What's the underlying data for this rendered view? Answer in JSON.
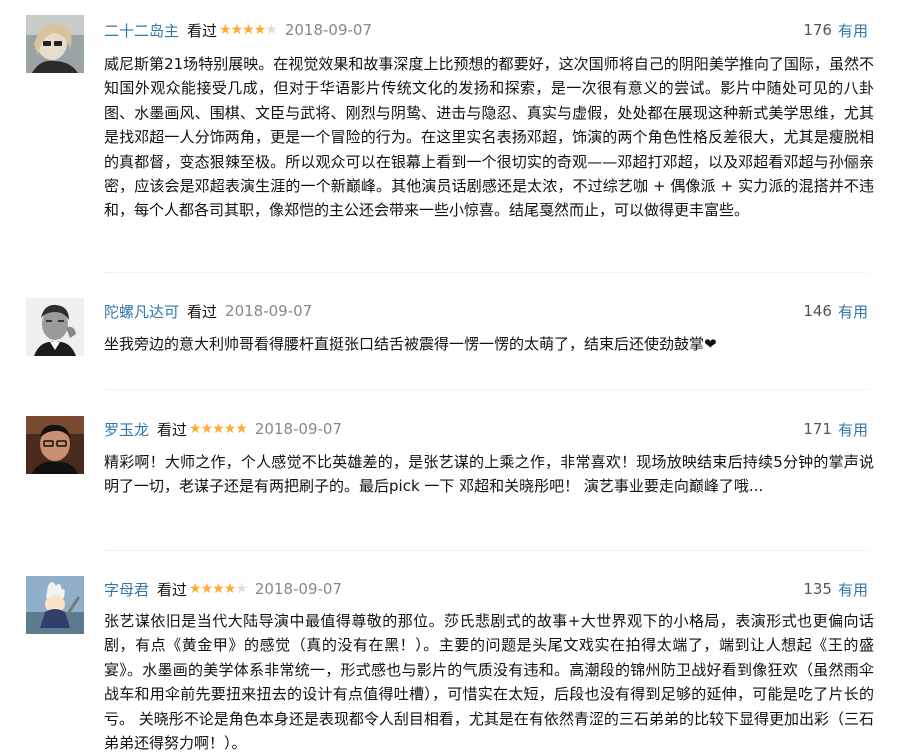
{
  "comments": [
    {
      "username": "二十二岛主",
      "status": "看过",
      "rating": 4,
      "date": "2018-09-07",
      "votes": "176",
      "useful_label": "有用",
      "content": "威尼斯第21场特别展映。在视觉效果和故事深度上比预想的都要好，这次国师将自己的阴阳美学推向了国际，虽然不知国外观众能接受几成，但对于华语影片传统文化的发扬和探索，是一次很有意义的尝试。影片中随处可见的八卦图、水墨画风、围棋、文臣与武将、刚烈与阴鸷、进击与隐忍、真实与虚假，处处都在展现这种新式美学思维，尤其是找邓超一人分饰两角，更是一个冒险的行为。在这里实名表扬邓超，饰演的两个角色性格反差很大，尤其是瘦脱相的真都督，变态狠辣至极。所以观众可以在银幕上看到一个很切实的奇观——邓超打邓超，以及邓超看邓超与孙俪亲密，应该会是邓超表演生涯的一个新巅峰。其他演员话剧感还是太浓，不过综艺咖 + 偶像派 + 实力派的混搭并不违和，每个人都各司其职，像郑恺的主公还会带来一些小惊喜。结尾戛然而止，可以做得更丰富些。"
    },
    {
      "username": "陀螺凡达可",
      "status": "看过",
      "rating": 0,
      "date": "2018-09-07",
      "votes": "146",
      "useful_label": "有用",
      "content": "坐我旁边的意大利帅哥看得腰杆直挺张口结舌被震得一愣一愣的太萌了，结束后还使劲鼓掌❤"
    },
    {
      "username": "罗玉龙",
      "status": "看过",
      "rating": 5,
      "date": "2018-09-07",
      "votes": "171",
      "useful_label": "有用",
      "content": "精彩啊！大师之作，个人感觉不比英雄差的，是张艺谋的上乘之作，非常喜欢！现场放映结束后持续5分钟的掌声说明了一切，老谋子还是有两把刷子的。最后pick 一下 邓超和关晓彤吧！ 演艺事业要走向巅峰了哦..."
    },
    {
      "username": "字母君",
      "status": "看过",
      "rating": 4,
      "date": "2018-09-07",
      "votes": "135",
      "useful_label": "有用",
      "content": "张艺谋依旧是当代大陆导演中最值得尊敬的那位。莎氏悲剧式的故事+大世界观下的小格局，表演形式也更偏向话剧，有点《黄金甲》的感觉（真的没有在黑！）。主要的问题是头尾文戏实在拍得太端了，端到让人想起《王的盛宴》。水墨画的美学体系非常统一，形式感也与影片的气质没有违和。高潮段的锦州防卫战好看到像狂欢（虽然雨伞战车和用伞前先要扭来扭去的设计有点值得吐槽），可惜实在太短，后段也没有得到足够的延伸，可能是吃了片长的亏。 关晓彤不论是角色本身还是表现都令人刮目相看，尤其是在有依然青涩的三石弟弟的比较下显得更加出彩（三石弟弟还得努力啊！）。"
    }
  ],
  "colors": {
    "link": "#3377aa",
    "star_on": "#ffac2d",
    "star_off": "#dddddd",
    "meta": "#888888"
  }
}
